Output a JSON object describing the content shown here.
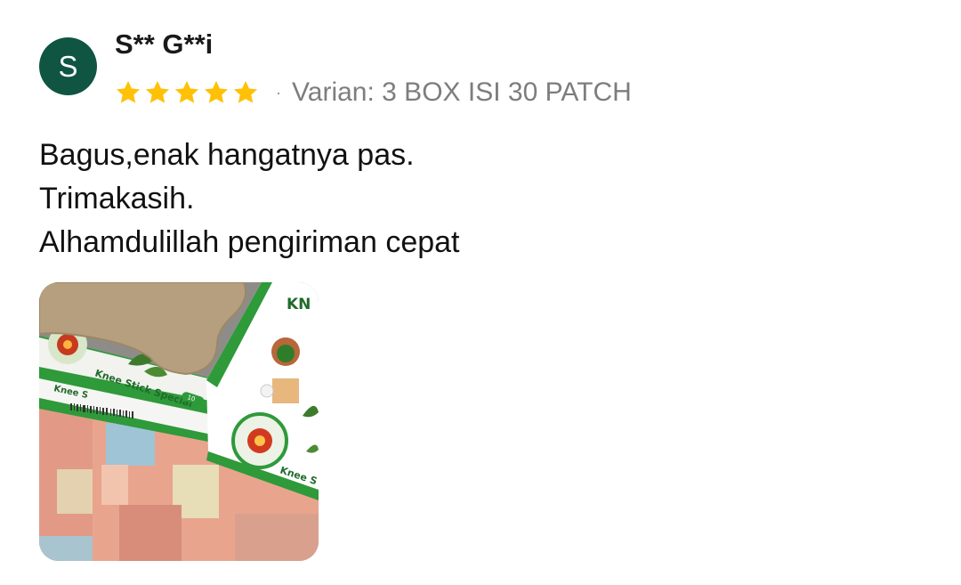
{
  "reviewer": {
    "avatar_letter": "S",
    "avatar_color": "#0f5542",
    "name": "S** G**i"
  },
  "rating": {
    "stars": 5,
    "max_stars": 5,
    "star_color": "#ffc107"
  },
  "meta": {
    "separator": "·",
    "variant": "Varian: 3 BOX ISI 30 PATCH"
  },
  "review_lines": [
    "Bagus,enak hangatnya pas.",
    "Trimakasih.",
    "Alhamdulillah pengiriman cepat"
  ],
  "photo": {
    "icon": "review-photo-thumbnail",
    "box_text_1": "Knee Stick Special",
    "box_text_2": "Knee S",
    "box_text_3": "KN",
    "box_text_4": "Knee S",
    "box_text_5": "10"
  }
}
